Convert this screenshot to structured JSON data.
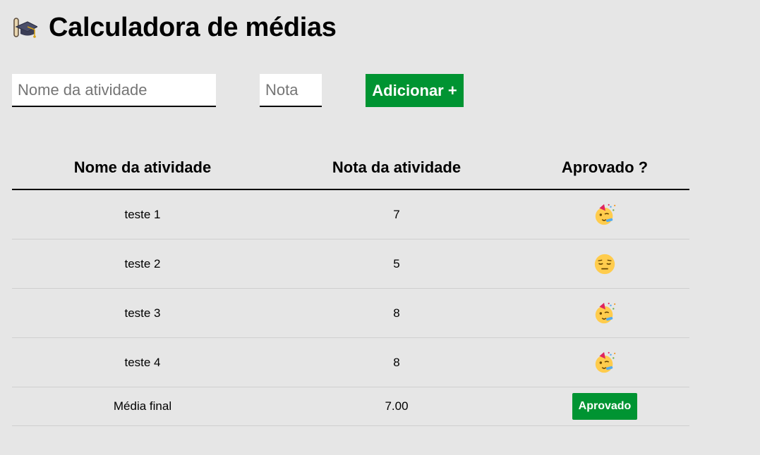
{
  "header": {
    "icon": "graduation-cap-icon",
    "title": "Calculadora de médias"
  },
  "form": {
    "name_placeholder": "Nome da atividade",
    "name_value": "",
    "grade_placeholder": "Nota",
    "grade_value": "",
    "add_label": "Adicionar +"
  },
  "table": {
    "headers": [
      "Nome da atividade",
      "Nota da atividade",
      "Aprovado ?"
    ],
    "rows": [
      {
        "name": "teste 1",
        "grade": "7",
        "status_icon": "party-face-icon"
      },
      {
        "name": "teste 2",
        "grade": "5",
        "status_icon": "pensive-face-icon"
      },
      {
        "name": "teste 3",
        "grade": "8",
        "status_icon": "party-face-icon"
      },
      {
        "name": "teste 4",
        "grade": "8",
        "status_icon": "party-face-icon"
      }
    ],
    "footer": {
      "label": "Média final",
      "value": "7.00",
      "badge": "Aprovado"
    }
  },
  "colors": {
    "background": "#e6e6e6",
    "accent_green": "#009432",
    "emoji_yellow": "#ffcc4d"
  }
}
